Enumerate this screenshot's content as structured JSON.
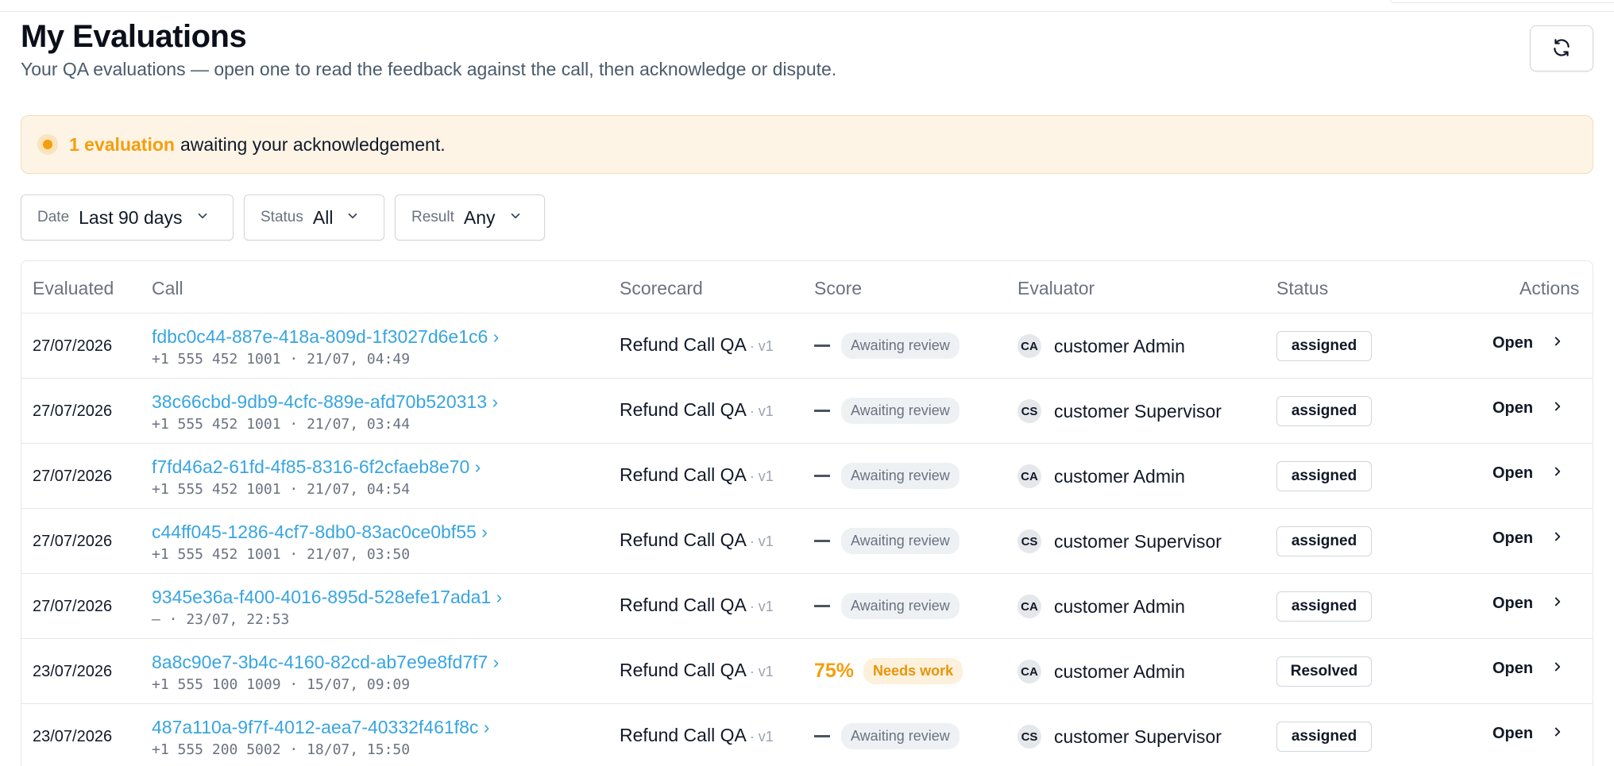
{
  "page": {
    "title": "My Evaluations",
    "subtitle": "Your QA evaluations — open one to read the feedback against the call, then acknowledge or dispute."
  },
  "toolbar": {
    "refresh_icon": "refresh-icon"
  },
  "banner": {
    "count_text": "1 evaluation",
    "message": "awaiting your acknowledgement.",
    "accent_color": "#f59e0b"
  },
  "filters": {
    "date": {
      "label": "Date",
      "value": "Last 90 days"
    },
    "status": {
      "label": "Status",
      "value": "All"
    },
    "result": {
      "label": "Result",
      "value": "Any"
    }
  },
  "table": {
    "columns": {
      "evaluated": "Evaluated",
      "call": "Call",
      "scorecard": "Scorecard",
      "score": "Score",
      "evaluator": "Evaluator",
      "status": "Status",
      "actions": "Actions"
    },
    "rows": [
      {
        "evaluated": "27/07/2026",
        "call_id": "fdbc0c44-887e-418a-809d-1f3027d6e1c6 ›",
        "call_meta": "+1 555 452 1001 · 21/07, 04:49",
        "scorecard": "Refund Call QA",
        "scorecard_version": "· v1",
        "score": "",
        "score_pill": "Awaiting review",
        "evaluator_initials": "CA",
        "evaluator": "customer Admin",
        "status": "assigned",
        "action": "Open"
      },
      {
        "evaluated": "27/07/2026",
        "call_id": "38c66cbd-9db9-4cfc-889e-afd70b520313 ›",
        "call_meta": "+1 555 452 1001 · 21/07, 03:44",
        "scorecard": "Refund Call QA",
        "scorecard_version": "· v1",
        "score": "",
        "score_pill": "Awaiting review",
        "evaluator_initials": "CS",
        "evaluator": "customer Supervisor",
        "status": "assigned",
        "action": "Open"
      },
      {
        "evaluated": "27/07/2026",
        "call_id": "f7fd46a2-61fd-4f85-8316-6f2cfaeb8e70 ›",
        "call_meta": "+1 555 452 1001 · 21/07, 04:54",
        "scorecard": "Refund Call QA",
        "scorecard_version": "· v1",
        "score": "",
        "score_pill": "Awaiting review",
        "evaluator_initials": "CA",
        "evaluator": "customer Admin",
        "status": "assigned",
        "action": "Open"
      },
      {
        "evaluated": "27/07/2026",
        "call_id": "c44ff045-1286-4cf7-8db0-83ac0ce0bf55 ›",
        "call_meta": "+1 555 452 1001 · 21/07, 03:50",
        "scorecard": "Refund Call QA",
        "scorecard_version": "· v1",
        "score": "",
        "score_pill": "Awaiting review",
        "evaluator_initials": "CS",
        "evaluator": "customer Supervisor",
        "status": "assigned",
        "action": "Open"
      },
      {
        "evaluated": "27/07/2026",
        "call_id": "9345e36a-f400-4016-895d-528efe17ada1 ›",
        "call_meta": "— · 23/07, 22:53",
        "scorecard": "Refund Call QA",
        "scorecard_version": "· v1",
        "score": "",
        "score_pill": "Awaiting review",
        "evaluator_initials": "CA",
        "evaluator": "customer Admin",
        "status": "assigned",
        "action": "Open"
      },
      {
        "evaluated": "23/07/2026",
        "call_id": "8a8c90e7-3b4c-4160-82cd-ab7e9e8fd7f7 ›",
        "call_meta": "+1 555 100 1009 · 15/07, 09:09",
        "scorecard": "Refund Call QA",
        "scorecard_version": "· v1",
        "score": "75%",
        "score_pill": "Needs work",
        "evaluator_initials": "CA",
        "evaluator": "customer Admin",
        "status": "Resolved",
        "action": "Open"
      },
      {
        "evaluated": "23/07/2026",
        "call_id": "487a110a-9f7f-4012-aea7-40332f461f8c ›",
        "call_meta": "+1 555 200 5002 · 18/07, 15:50",
        "scorecard": "Refund Call QA",
        "scorecard_version": "· v1",
        "score": "",
        "score_pill": "Awaiting review",
        "evaluator_initials": "CS",
        "evaluator": "customer Supervisor",
        "status": "assigned",
        "action": "Open"
      }
    ]
  },
  "colors": {
    "link": "#38a5e0",
    "warning": "#f59e0b",
    "muted": "#6b7280"
  }
}
